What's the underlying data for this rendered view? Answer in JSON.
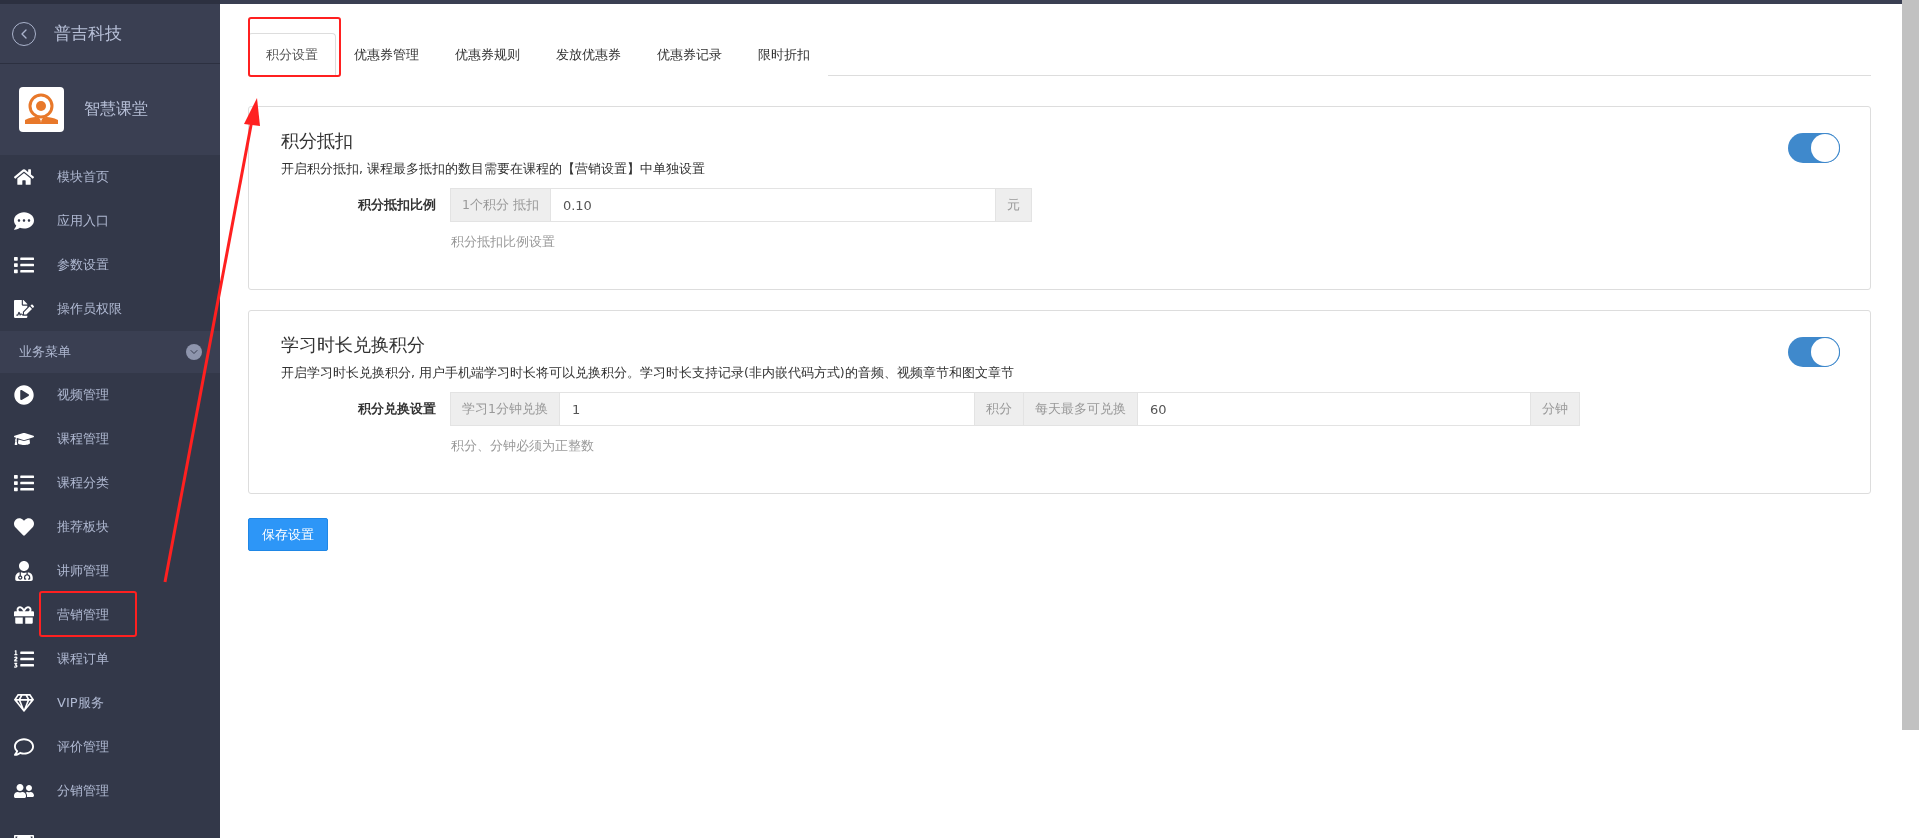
{
  "sidebar": {
    "header": {
      "title": "普吉科技"
    },
    "brand": {
      "name": "智慧课堂"
    },
    "items": [
      {
        "kind": "item",
        "label": "模块首页"
      },
      {
        "kind": "item",
        "label": "应用入口"
      },
      {
        "kind": "item",
        "label": "参数设置"
      },
      {
        "kind": "item",
        "label": "操作员权限"
      },
      {
        "kind": "section",
        "label": "业务菜单",
        "expanded": true
      },
      {
        "kind": "item",
        "label": "视频管理"
      },
      {
        "kind": "item",
        "label": "课程管理"
      },
      {
        "kind": "item",
        "label": "课程分类"
      },
      {
        "kind": "item",
        "label": "推荐板块"
      },
      {
        "kind": "item",
        "label": "讲师管理"
      },
      {
        "kind": "item",
        "label": "营销管理"
      },
      {
        "kind": "item",
        "label": "课程订单"
      },
      {
        "kind": "item",
        "label": "VIP服务"
      },
      {
        "kind": "item",
        "label": "评价管理"
      },
      {
        "kind": "item",
        "label": "分销管理"
      }
    ]
  },
  "tabs": [
    {
      "label": "积分设置",
      "selected": true
    },
    {
      "label": "优惠券管理",
      "selected": false
    },
    {
      "label": "优惠券规则",
      "selected": false
    },
    {
      "label": "发放优惠券",
      "selected": false
    },
    {
      "label": "优惠券记录",
      "selected": false
    },
    {
      "label": "限时折扣",
      "selected": false
    }
  ],
  "cards": [
    {
      "title": "积分抵扣",
      "description": "开启积分抵扣, 课程最多抵扣的数目需要在课程的【营销设置】中单独设置",
      "on": true,
      "field_label": "积分抵扣比例",
      "parts": [
        {
          "kind": "addon",
          "text": "1个积分 抵扣"
        },
        {
          "kind": "input",
          "value": "0.10"
        },
        {
          "kind": "addon",
          "text": "元"
        }
      ],
      "help": "积分抵扣比例设置"
    },
    {
      "title": "学习时长兑换积分",
      "description": "开启学习时长兑换积分, 用户手机端学习时长将可以兑换积分。学习时长支持记录(非内嵌代码方式)的音频、视频章节和图文章节",
      "on": true,
      "field_label": "积分兑换设置",
      "parts": [
        {
          "kind": "addon",
          "text": "学习1分钟兑换"
        },
        {
          "kind": "input",
          "value": "1"
        },
        {
          "kind": "addon",
          "text": "积分"
        },
        {
          "kind": "addon",
          "text": "每天最多可兑换"
        },
        {
          "kind": "input",
          "value": "60"
        },
        {
          "kind": "addon",
          "text": "分钟"
        }
      ],
      "help": "积分、分钟必须为正整数"
    }
  ],
  "save_button": "保存设置"
}
